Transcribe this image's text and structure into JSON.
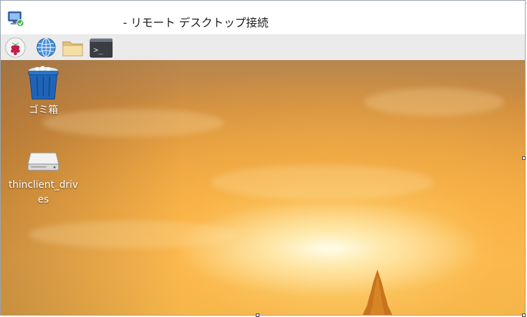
{
  "window": {
    "title": "- リモート デスクトップ接続"
  },
  "icons": {
    "app_icon": "remote-desktop-icon",
    "panel": [
      "raspberry-menu-icon",
      "web-browser-icon",
      "file-manager-icon",
      "terminal-icon"
    ]
  },
  "panel": {
    "terminal_glyph": ">_"
  },
  "desktop": {
    "items": [
      {
        "label": "ゴミ箱",
        "icon": "trash-icon"
      },
      {
        "label": "thinclient_drives",
        "icon": "drive-icon"
      }
    ]
  },
  "colors": {
    "panel_bg": "#ebebeb",
    "sky_top": "#b7864f",
    "sky_mid": "#f3a83f",
    "sun_glow": "#fff8e0"
  }
}
